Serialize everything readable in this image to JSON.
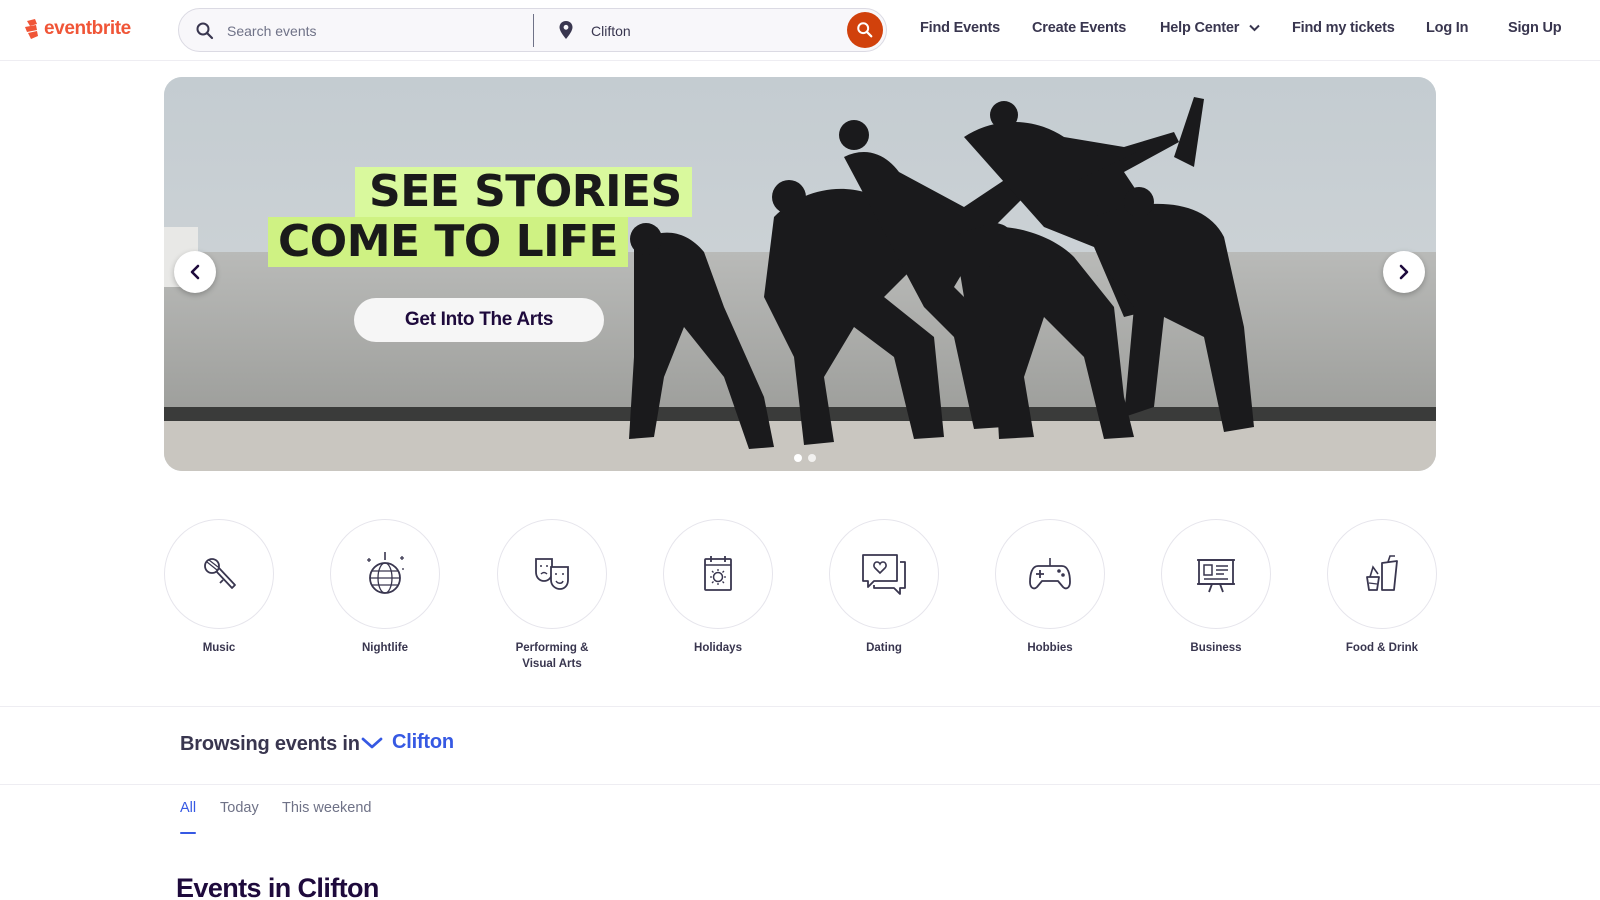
{
  "header": {
    "logo_text": "eventbrite",
    "search_placeholder": "Search events",
    "location_value": "Clifton",
    "nav": {
      "find_events": "Find Events",
      "create_events": "Create Events",
      "help_center": "Help Center",
      "find_tickets": "Find my tickets",
      "log_in": "Log In",
      "sign_up": "Sign Up"
    }
  },
  "hero": {
    "headline_line1": "SEE STORIES",
    "headline_line2": "COME TO LIFE",
    "cta_label": "Get Into The Arts",
    "slide_count": 2,
    "active_slide": 1
  },
  "categories": [
    {
      "label": "Music",
      "icon": "microphone-icon"
    },
    {
      "label": "Nightlife",
      "icon": "disco-ball-icon"
    },
    {
      "label": "Performing & Visual Arts",
      "icon": "theater-masks-icon"
    },
    {
      "label": "Holidays",
      "icon": "calendar-icon"
    },
    {
      "label": "Dating",
      "icon": "chat-heart-icon"
    },
    {
      "label": "Hobbies",
      "icon": "game-controller-icon"
    },
    {
      "label": "Business",
      "icon": "presentation-board-icon"
    },
    {
      "label": "Food & Drink",
      "icon": "drinks-icon"
    }
  ],
  "browse": {
    "lead": "Browsing events in",
    "location": "Clifton"
  },
  "tabs": [
    {
      "label": "All",
      "active": true
    },
    {
      "label": "Today",
      "active": false
    },
    {
      "label": "This weekend",
      "active": false
    }
  ],
  "section_title": "Events in Clifton",
  "colors": {
    "brand": "#f05537",
    "search_button": "#d1410c",
    "accent_blue": "#3659e3",
    "highlight_green": "#d9f99d"
  }
}
